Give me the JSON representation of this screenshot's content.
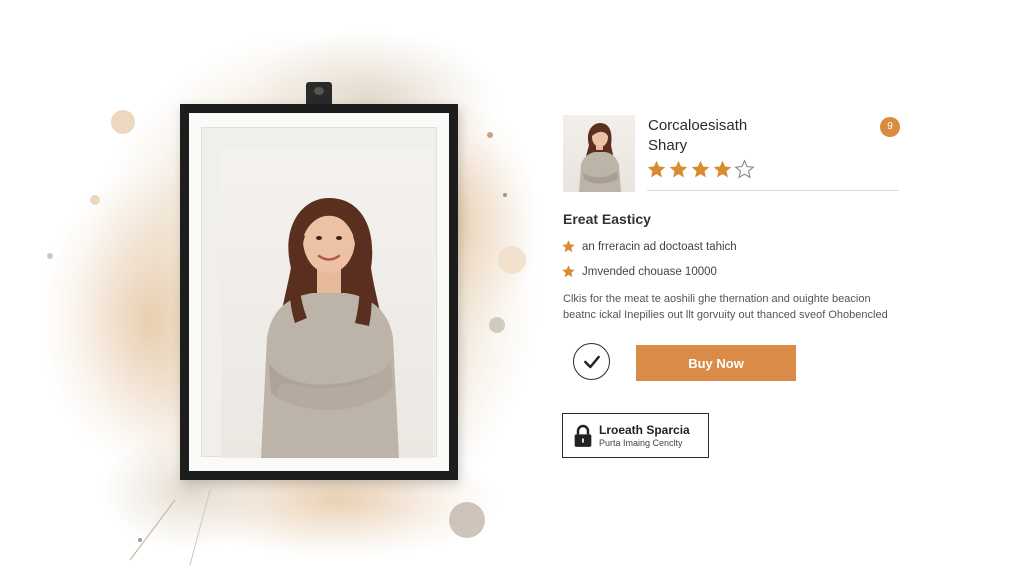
{
  "product": {
    "title_line1": "Corcaloesisath",
    "title_line2": "Shary",
    "badge": "9",
    "rating": 4,
    "rating_max": 5,
    "star_color": "#d98b2f"
  },
  "features": {
    "heading": "Ereat Easticy",
    "items": [
      "an frreracin ad doctoast tahich",
      "Jmvended chouase 10000"
    ]
  },
  "description": {
    "line1": "Clkis for the meat te aoshili ghe thernation and ouighte beacion",
    "line2": "beatnc ickal Inepilies out llt gorvuity out thanced sveof Ohobencled"
  },
  "actions": {
    "buy_label": "Buy Now",
    "accent_color": "#d98b47"
  },
  "secure_badge": {
    "title": "Lroeath Sparcia",
    "subtitle": "Purta Imaing Cenclty"
  }
}
